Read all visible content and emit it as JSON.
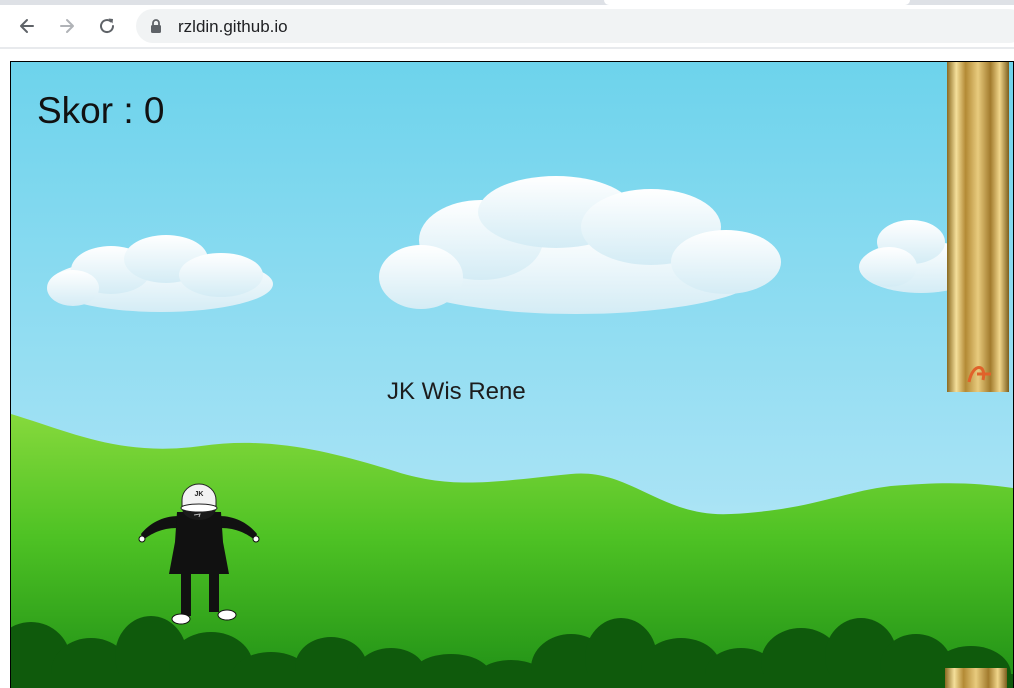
{
  "browser": {
    "url": "rzldin.github.io"
  },
  "game": {
    "score_text": "Skor : 0",
    "caption": "JK Wis Rene",
    "player_cap_text": "JK",
    "colors": {
      "sky_top": "#6dd3ec",
      "sky_bottom": "#d6f1fb",
      "hill": "#7fd63a",
      "grass_dark": "#1e7a14",
      "bush": "#0f5a0c",
      "pipe_gold": "#c9a24a"
    }
  }
}
